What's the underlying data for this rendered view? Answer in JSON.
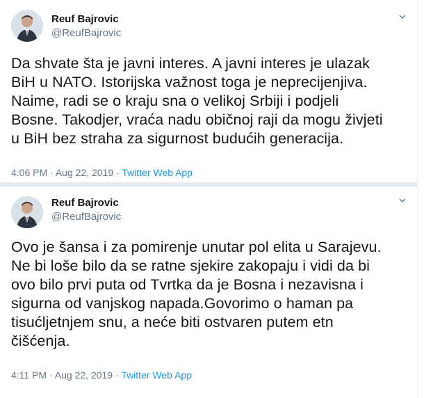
{
  "tweets": [
    {
      "author_name": "Reuf Bajrovic",
      "author_handle": "@ReufBajrovic",
      "text": "Da shvate šta je javni interes. A javni interes je ulazak\nBiH u NATO. Istorijska važnost toga je neprecijenjiva.\nNaime, radi se o kraju sna o velikoj Srbiji i podjeli\nBosne. Takodjer, vraća nadu običnoj raji da mogu živjeti\nu BiH bez straha za sigurnost budućih generacija.",
      "time": "4:06 PM",
      "date": "Aug 22, 2019",
      "separator": "·",
      "source": "Twitter Web App",
      "caret_icon": "chevron-down-icon"
    },
    {
      "author_name": "Reuf Bajrovic",
      "author_handle": "@ReufBajrovic",
      "text": "Ovo je šansa i za pomirenje unutar pol elita u Sarajevu.\nNe bi loše bilo da se ratne sjekire zakopaju i vidi da bi\novo bilo prvi puta od Tvrtka da je Bosna i nezavisna i\nsigurna od vanjskog napada.Govorimo o haman pa\ntisućljetnjem snu, a neće biti ostvaren putem etn\nčišćenja.",
      "time": "4:11 PM",
      "date": "Aug 22, 2019",
      "separator": "·",
      "source": "Twitter Web App",
      "caret_icon": "chevron-down-icon"
    }
  ],
  "colors": {
    "text": "#14171a",
    "secondary": "#657786",
    "link": "#1b95e0",
    "divider": "#e6ecf0"
  }
}
